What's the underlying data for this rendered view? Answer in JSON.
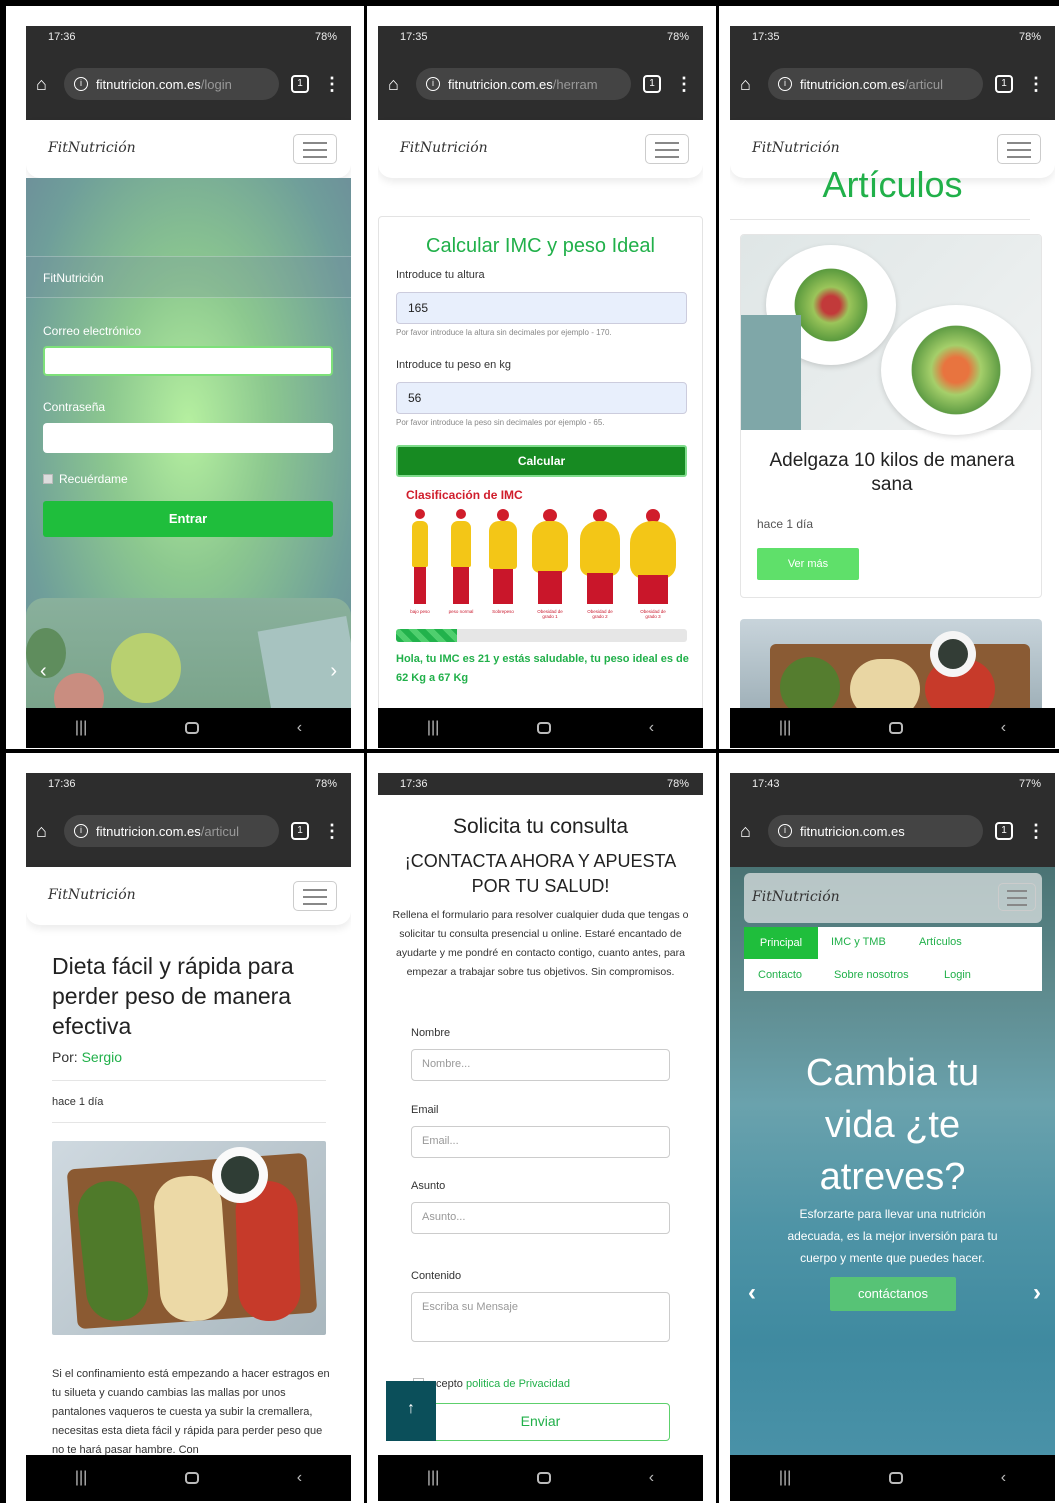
{
  "status": {
    "p1_time": "17:36",
    "p2_time": "17:35",
    "p3_time": "17:35",
    "p4_time": "17:36",
    "p5_time": "17:36",
    "p6_time": "17:43",
    "battery_78": "78%",
    "battery_77": "77%"
  },
  "urls": {
    "login_host": "fitnutricion.com.es",
    "login_path": "/login",
    "tool_host": "fitnutricion.com.es",
    "tool_path": "/herram",
    "art_host": "fitnutricion.com.es",
    "art_path": "/articul",
    "home": "fitnutricion.com.es",
    "tab_count": "1"
  },
  "brand": "FitNutrición",
  "login": {
    "site_name": "FitNutrición",
    "email_label": "Correo electrónico",
    "password_label": "Contraseña",
    "remember": "Recuérdame",
    "submit": "Entrar"
  },
  "imc": {
    "title": "Calcular IMC y peso Ideal",
    "height_label": "Introduce tu altura",
    "height_value": "165",
    "height_help": "Por favor introduce la altura sin decimales por ejemplo - 170.",
    "weight_label": "Introduce tu peso en kg",
    "weight_value": "56",
    "weight_help": "Por favor introduce la peso sin decimales por ejemplo - 65.",
    "button": "Calcular",
    "classif_title": "Clasificación de IMC",
    "figures": [
      "bajo peso",
      "peso normal",
      "Sobrepeso",
      "Obesidad de grado 1",
      "Obesidad de grado 2",
      "Obesidad de grado 3"
    ],
    "progress_fraction": 0.21,
    "result": "Hola, tu IMC es 21 y estás saludable, tu peso ideal es de 62 Kg a 67 Kg"
  },
  "articles": {
    "heading": "Artículos",
    "card_title": "Adelgaza 10 kilos de manera sana",
    "card_time": "hace 1 día",
    "card_button": "Ver más"
  },
  "article": {
    "title": "Dieta fácil y rápida para perder peso de manera efectiva",
    "by_label": "Por:",
    "author": "Sergio",
    "time": "hace 1 día",
    "body": "Si el confinamiento está empezando a hacer estragos en tu silueta y cuando cambias las mallas por unos pantalones vaqueros te cuesta ya subir la cremallera, necesitas esta dieta fácil y rápida para perder peso que no te hará pasar hambre. Con"
  },
  "contact": {
    "title": "Solicita tu consulta",
    "subtitle": "¡CONTACTA AHORA Y APUESTA POR TU SALUD!",
    "intro": "Rellena el formulario para resolver cualquier duda que tengas o solicitar tu consulta presencial u online. Estaré encantado de ayudarte y me pondré en contacto contigo, cuanto antes, para empezar a trabajar sobre tus objetivos. Sin compromisos.",
    "name_label": "Nombre",
    "name_ph": "Nombre...",
    "email_label": "Email",
    "email_ph": "Email...",
    "subject_label": "Asunto",
    "subject_ph": "Asunto...",
    "content_label": "Contenido",
    "content_ph": "Escriba su Mensaje",
    "accept_prefix": "cepto",
    "privacy_link": "politica de Privacidad",
    "send": "Enviar"
  },
  "home": {
    "menu": [
      "Principal",
      "IMC y TMB",
      "Artículos",
      "Contacto",
      "Sobre nosotros",
      "Login"
    ],
    "hero_title": "Cambia tu vida ¿te atreves?",
    "hero_text": "Esforzarte para llevar una nutrición adecuada, es la mejor inversión para tu cuerpo y mente que puedes hacer.",
    "cta": "contáctanos"
  },
  "colors": {
    "accent": "#21b04a",
    "button": "#1fbe3c",
    "dark_button": "#178a22",
    "teal": "#0b4f5a"
  }
}
